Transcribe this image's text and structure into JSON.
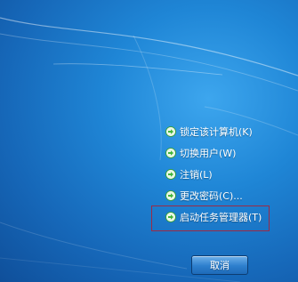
{
  "menu": {
    "items": [
      {
        "label": "锁定该计算机(K)"
      },
      {
        "label": "切换用户(W)"
      },
      {
        "label": "注销(L)"
      },
      {
        "label": "更改密码(C)..."
      },
      {
        "label": "启动任务管理器(T)"
      }
    ]
  },
  "cancel_label": "取消",
  "colors": {
    "background": "#1f86d6",
    "highlight_border": "#9b2b46",
    "arrow_green": "#57c84d"
  },
  "icons": {
    "menu_item": "green-arrow-icon"
  }
}
